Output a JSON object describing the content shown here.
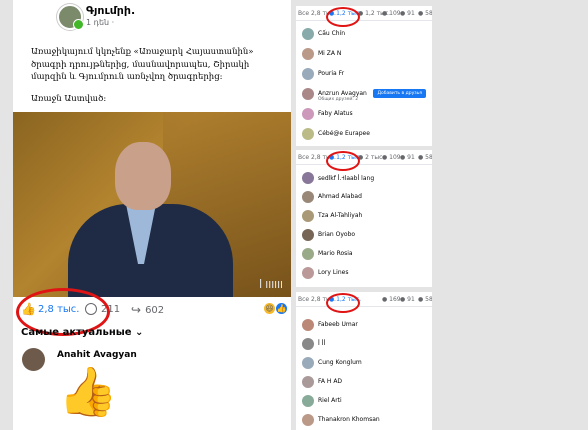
{
  "post": {
    "author": "Գյումրի.",
    "time": "1 դեն ·",
    "paragraph1": "Առաջիկայում կկոչենք «Առաջարկ Հայաստանին» ծրագրի դրույթներից, մասնավորապես, Շիրակի մարզին և Գյումրուն առնչվող ծրագրերից:",
    "paragraph2": "Առաջն Աստված:",
    "photo_watermark": "ꟾ IIIIII",
    "likes": "2,8 тыс.",
    "comments": "211",
    "shares": "602",
    "sort_label": "Самые актуальные",
    "comment_author": "Anahit Avagyan",
    "sticker": "👍"
  },
  "colors": {
    "brand": "#1877f2",
    "annotation": "#e01414"
  },
  "panels": [
    {
      "all": "Все 2,8 тыс.",
      "like": "1,2 тыс.",
      "love": "1,2 тыс.",
      "c3": "109",
      "c4": "91",
      "c5": "58",
      "rows": [
        {
          "name": "Cấu Chín",
          "color": "#8aa"
        },
        {
          "name": "Mi ZA N",
          "color": "#b98"
        },
        {
          "name": "Pouria Fr",
          "color": "#9ab"
        },
        {
          "name": "Anzrun Avagyan",
          "sub": "Общих друзей: 2",
          "color": "#a88",
          "button": "Добавить в друзья"
        },
        {
          "name": "Faby Alatus",
          "color": "#c9b"
        },
        {
          "name": "Cébé@e Eurapee",
          "color": "#bb8"
        }
      ]
    },
    {
      "all": "Все 2,8 тыс.",
      "like": "1,2 тыс.",
      "love": "2 тыс.",
      "c3": "109",
      "c4": "91",
      "c5": "58",
      "rows": [
        {
          "name": "sedlkf ꟾ.Ꟶlaabꟾ lang",
          "color": "#879"
        },
        {
          "name": "Ahmad Alabad",
          "color": "#987"
        },
        {
          "name": "Tza Al-Tahliyah",
          "color": "#a97"
        },
        {
          "name": "Brian Oyobo",
          "color": "#765"
        },
        {
          "name": "Mario Rosia",
          "color": "#9a8"
        },
        {
          "name": "Lory Lines",
          "color": "#b99"
        }
      ]
    },
    {
      "all": "Все 2,8 тыс.",
      "like": "1,2 тыс.",
      "love": "",
      "c3": "169",
      "c4": "91",
      "c5": "58",
      "rows": [
        {
          "name": "Fabeeb Umar",
          "color": "#b87"
        },
        {
          "name": "ꟾ ꟾꟾ",
          "color": "#888"
        },
        {
          "name": "Cung Konglum",
          "color": "#9ab"
        },
        {
          "name": "FA H AD",
          "color": "#a99"
        },
        {
          "name": "Riel Arti",
          "color": "#8a9"
        },
        {
          "name": "Thanakron Khomsan",
          "color": "#b98"
        }
      ]
    }
  ]
}
